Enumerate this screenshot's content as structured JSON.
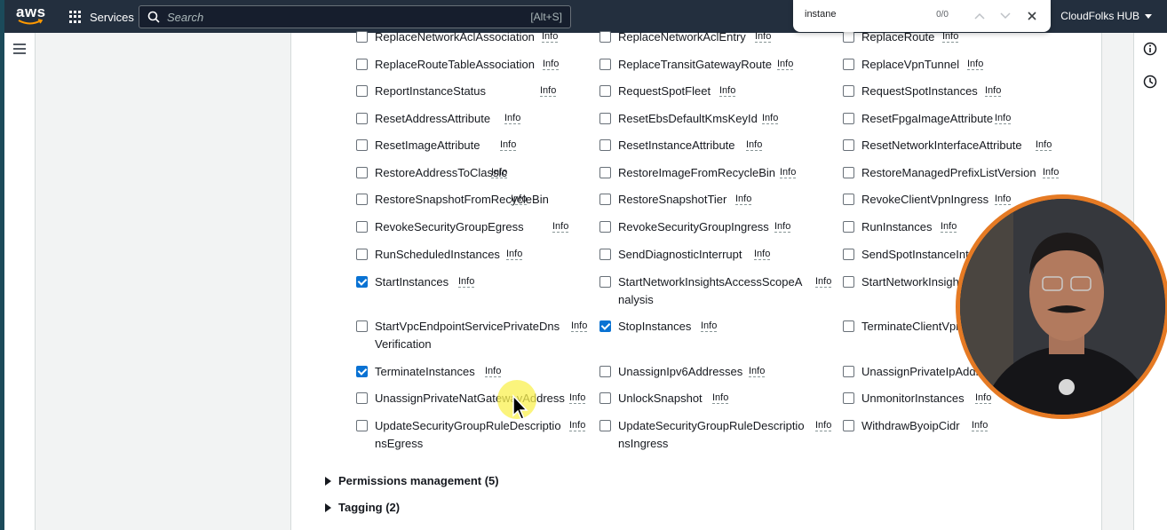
{
  "topnav": {
    "logo": "aws",
    "services_label": "Services",
    "search_placeholder": "Search",
    "search_shortcut": "[Alt+S]",
    "account_label": "CloudFolks HUB"
  },
  "findbar": {
    "query": "instane",
    "count": "0/0"
  },
  "info_label": "Info",
  "actions": [
    {
      "label": "ReplaceNetworkAclAssociation",
      "checked": false
    },
    {
      "label": "ReplaceNetworkAclEntry",
      "checked": false
    },
    {
      "label": "ReplaceRoute",
      "checked": false
    },
    {
      "label": "ReplaceRouteTableAssociation",
      "checked": false
    },
    {
      "label": "ReplaceTransitGatewayRoute",
      "checked": false
    },
    {
      "label": "ReplaceVpnTunnel",
      "checked": false
    },
    {
      "label": "ReportInstanceStatus",
      "checked": false
    },
    {
      "label": "RequestSpotFleet",
      "checked": false
    },
    {
      "label": "RequestSpotInstances",
      "checked": false
    },
    {
      "label": "ResetAddressAttribute",
      "checked": false
    },
    {
      "label": "ResetEbsDefaultKmsKeyId",
      "checked": false
    },
    {
      "label": "ResetFpgaImageAttribute",
      "checked": false
    },
    {
      "label": "ResetImageAttribute",
      "checked": false
    },
    {
      "label": "ResetInstanceAttribute",
      "checked": false
    },
    {
      "label": "ResetNetworkInterfaceAttribute",
      "checked": false
    },
    {
      "label": "RestoreAddressToClassic",
      "checked": false
    },
    {
      "label": "RestoreImageFromRecycleBin",
      "checked": false
    },
    {
      "label": "RestoreManagedPrefixListVersion",
      "checked": false
    },
    {
      "label": "RestoreSnapshotFromRecycleBin",
      "checked": false
    },
    {
      "label": "RestoreSnapshotTier",
      "checked": false
    },
    {
      "label": "RevokeClientVpnIngress",
      "checked": false
    },
    {
      "label": "RevokeSecurityGroupEgress",
      "checked": false
    },
    {
      "label": "RevokeSecurityGroupIngress",
      "checked": false
    },
    {
      "label": "RunInstances",
      "checked": false
    },
    {
      "label": "RunScheduledInstances",
      "checked": false
    },
    {
      "label": "SendDiagnosticInterrupt",
      "checked": false
    },
    {
      "label": "SendSpotInstanceInte",
      "checked": false
    },
    {
      "label": "StartInstances",
      "checked": true
    },
    {
      "label": "StartNetworkInsightsAccessScopeA",
      "label2": "nalysis",
      "checked": false
    },
    {
      "label": "StartNetworkInsigh",
      "checked": false
    },
    {
      "label": "StartVpcEndpointServicePrivateDns",
      "label2": "Verification",
      "checked": false
    },
    {
      "label": "StopInstances",
      "checked": true
    },
    {
      "label": "TerminateClientVpn",
      "checked": false
    },
    {
      "label": "TerminateInstances",
      "checked": true
    },
    {
      "label": "UnassignIpv6Addresses",
      "checked": false
    },
    {
      "label": "UnassignPrivateIpAddr",
      "checked": false
    },
    {
      "label": "UnassignPrivateNatGatewayAddress",
      "checked": false
    },
    {
      "label": "UnlockSnapshot",
      "checked": false
    },
    {
      "label": "UnmonitorInstances",
      "checked": false
    },
    {
      "label": "UpdateSecurityGroupRuleDescriptio",
      "label2": "nsEgress",
      "checked": false
    },
    {
      "label": "UpdateSecurityGroupRuleDescriptio",
      "label2": "nsIngress",
      "checked": false
    },
    {
      "label": "WithdrawByoipCidr",
      "checked": false
    }
  ],
  "sections": [
    {
      "label": "Permissions management (5)"
    },
    {
      "label": "Tagging (2)"
    }
  ],
  "colors": {
    "nav_bg": "#232f3e",
    "checkbox_checked": "#0972d3",
    "webcam_ring": "#e57a24"
  }
}
